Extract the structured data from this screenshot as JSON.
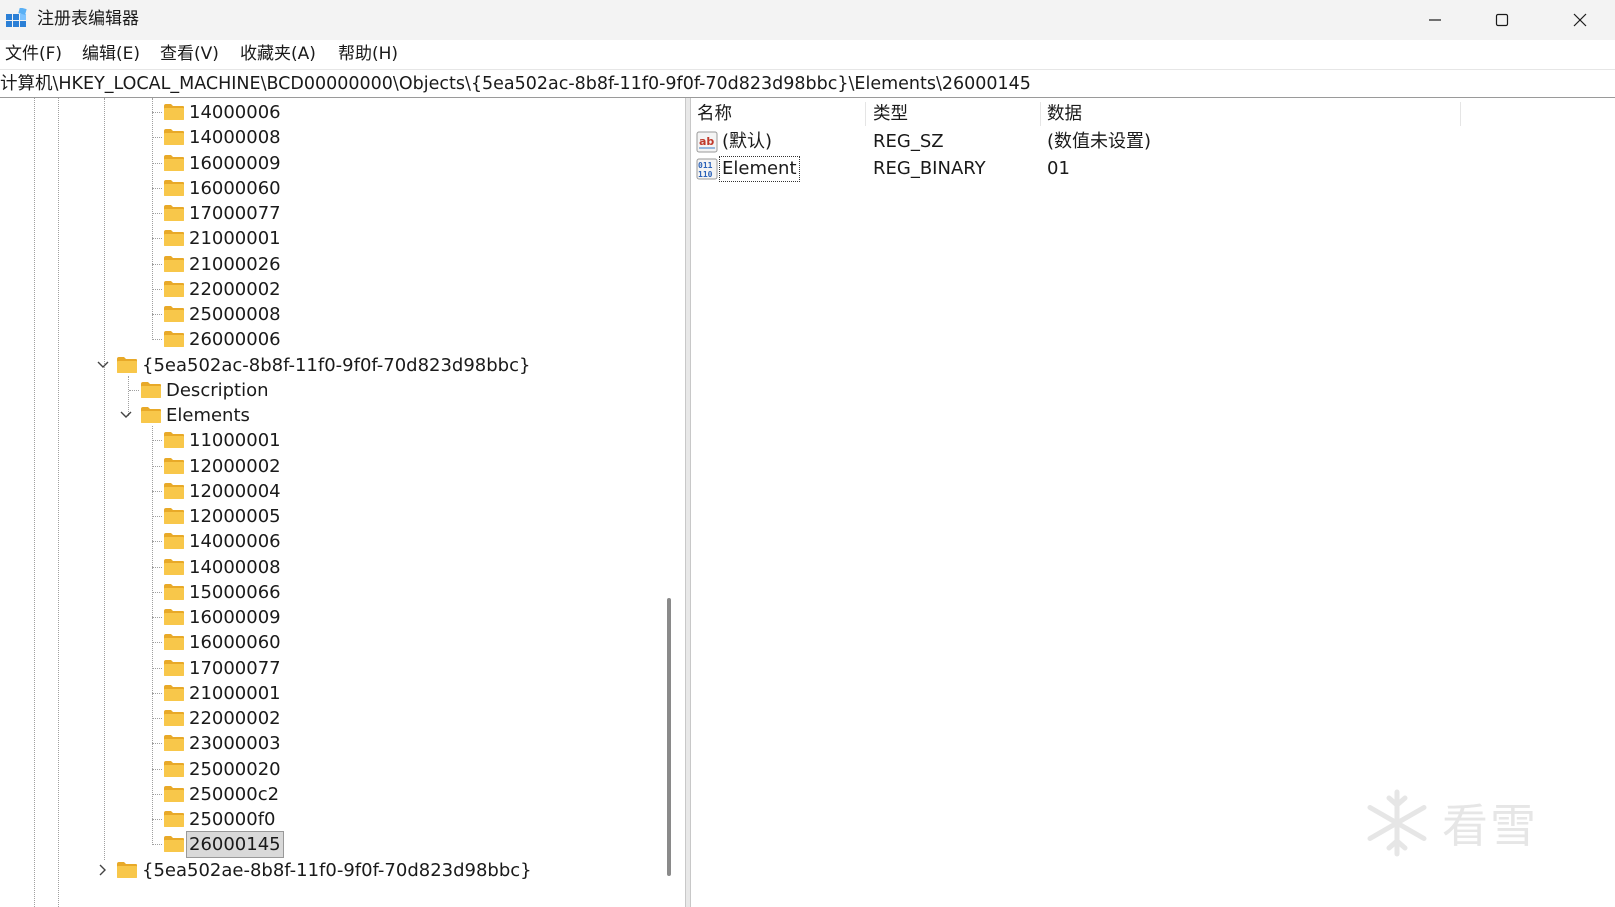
{
  "window": {
    "title": "注册表编辑器"
  },
  "menu": [
    "文件(F)",
    "编辑(E)",
    "查看(V)",
    "收藏夹(A)",
    "帮助(H)"
  ],
  "address": "计算机\\HKEY_LOCAL_MACHINE\\BCD00000000\\Objects\\{5ea502ac-8b8f-11f0-9f0f-70d823d98bbc}\\Elements\\26000145",
  "tree": {
    "prev_elements": [
      "14000006",
      "14000008",
      "16000009",
      "16000060",
      "17000077",
      "21000001",
      "21000026",
      "22000002",
      "25000008",
      "26000006"
    ],
    "object_key": "{5ea502ac-8b8f-11f0-9f0f-70d823d98bbc}",
    "description": "Description",
    "elements": "Elements",
    "element_keys": [
      "11000001",
      "12000002",
      "12000004",
      "12000005",
      "14000006",
      "14000008",
      "15000066",
      "16000009",
      "16000060",
      "17000077",
      "21000001",
      "22000002",
      "23000003",
      "25000020",
      "250000c2",
      "250000f0",
      "26000145"
    ],
    "selected": "26000145",
    "next_object_key": "{5ea502ae-8b8f-11f0-9f0f-70d823d98bbc}"
  },
  "values": {
    "columns": [
      "名称",
      "类型",
      "数据"
    ],
    "rows": [
      {
        "name": "(默认)",
        "type": "REG_SZ",
        "data": "(数值未设置)",
        "icon": "string-value-icon"
      },
      {
        "name": "Element",
        "type": "REG_BINARY",
        "data": "01",
        "icon": "binary-value-icon"
      }
    ]
  },
  "watermark": {
    "text": "看雪",
    "icon": "snowflake-icon"
  },
  "colors": {
    "folder": "#F8C74A",
    "selection": "#D9D9D9",
    "titlebar": "#F3F3F3"
  }
}
